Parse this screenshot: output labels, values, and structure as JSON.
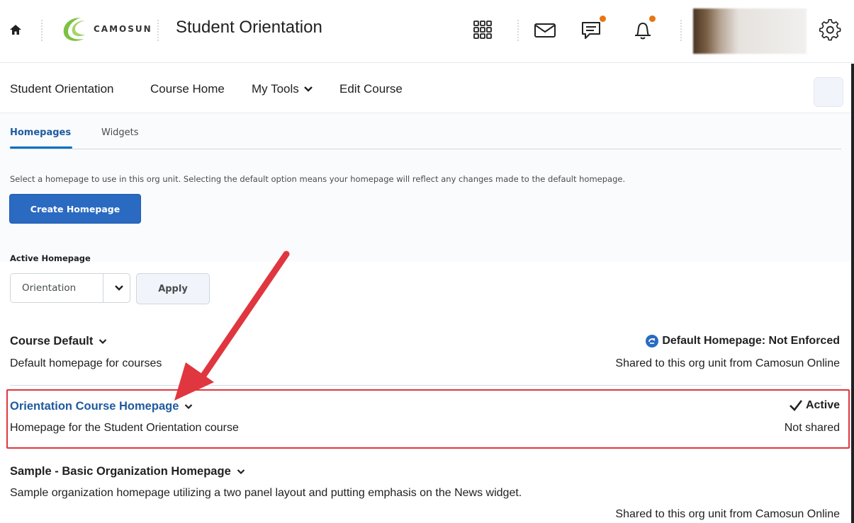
{
  "header": {
    "logo_text": "CAMOSUN",
    "course_title": "Student Orientation"
  },
  "navbar": {
    "items": [
      {
        "label": "Student Orientation"
      },
      {
        "label": "Course Home"
      },
      {
        "label": "My Tools"
      },
      {
        "label": "Edit Course"
      }
    ]
  },
  "tabs": [
    {
      "label": "Homepages",
      "active": true
    },
    {
      "label": "Widgets",
      "active": false
    }
  ],
  "description": "Select a homepage to use in this org unit. Selecting the default option means your homepage will reflect any changes made to the default homepage.",
  "create_button": "Create Homepage",
  "active_homepage": {
    "label": "Active Homepage",
    "selected": "Orientation",
    "apply_label": "Apply"
  },
  "homepages": [
    {
      "title": "Course Default",
      "description": "Default homepage for courses",
      "status": "Default Homepage: Not Enforced",
      "sharing": "Shared to this org unit from Camosun Online"
    },
    {
      "title": "Orientation Course Homepage",
      "description": "Homepage for the Student Orientation course",
      "status": "Active",
      "sharing": "Not shared"
    },
    {
      "title": "Sample - Basic Organization Homepage",
      "description": "Sample organization homepage utilizing a two panel layout and putting emphasis on the News widget.",
      "sharing": "Shared to this org unit from Camosun Online"
    }
  ],
  "colors": {
    "link": "#1e5a9e",
    "primary_button": "#2a6ac1",
    "notification_dot": "#e87511",
    "annotation_red": "#e0363f"
  }
}
